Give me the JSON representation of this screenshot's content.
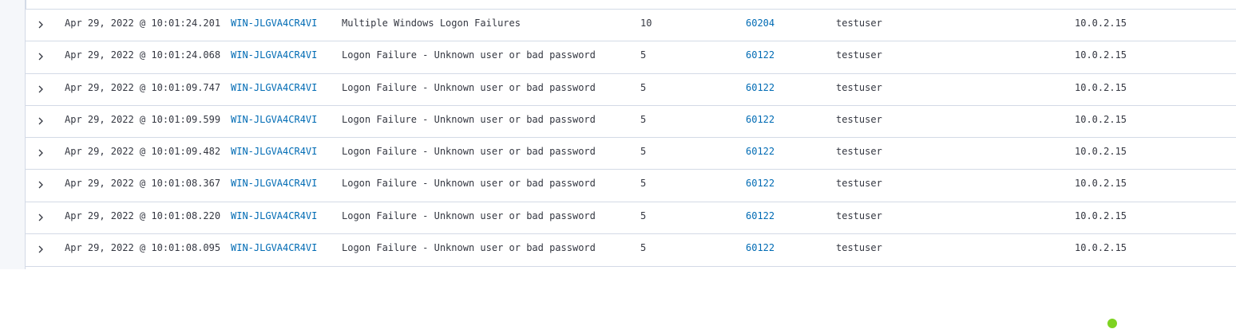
{
  "alerts_table": {
    "rows": [
      {
        "timestamp": "Apr 29, 2022 @ 10:01:24.201",
        "agent": "WIN-JLGVA4CR4VI",
        "description": "Multiple Windows Logon Failures",
        "level": "10",
        "rule_id": "60204",
        "user": "testuser",
        "ip": "10.0.2.15"
      },
      {
        "timestamp": "Apr 29, 2022 @ 10:01:24.068",
        "agent": "WIN-JLGVA4CR4VI",
        "description": "Logon Failure - Unknown user or bad password",
        "level": "5",
        "rule_id": "60122",
        "user": "testuser",
        "ip": "10.0.2.15"
      },
      {
        "timestamp": "Apr 29, 2022 @ 10:01:09.747",
        "agent": "WIN-JLGVA4CR4VI",
        "description": "Logon Failure - Unknown user or bad password",
        "level": "5",
        "rule_id": "60122",
        "user": "testuser",
        "ip": "10.0.2.15"
      },
      {
        "timestamp": "Apr 29, 2022 @ 10:01:09.599",
        "agent": "WIN-JLGVA4CR4VI",
        "description": "Logon Failure - Unknown user or bad password",
        "level": "5",
        "rule_id": "60122",
        "user": "testuser",
        "ip": "10.0.2.15"
      },
      {
        "timestamp": "Apr 29, 2022 @ 10:01:09.482",
        "agent": "WIN-JLGVA4CR4VI",
        "description": "Logon Failure - Unknown user or bad password",
        "level": "5",
        "rule_id": "60122",
        "user": "testuser",
        "ip": "10.0.2.15"
      },
      {
        "timestamp": "Apr 29, 2022 @ 10:01:08.367",
        "agent": "WIN-JLGVA4CR4VI",
        "description": "Logon Failure - Unknown user or bad password",
        "level": "5",
        "rule_id": "60122",
        "user": "testuser",
        "ip": "10.0.2.15"
      },
      {
        "timestamp": "Apr 29, 2022 @ 10:01:08.220",
        "agent": "WIN-JLGVA4CR4VI",
        "description": "Logon Failure - Unknown user or bad password",
        "level": "5",
        "rule_id": "60122",
        "user": "testuser",
        "ip": "10.0.2.15"
      },
      {
        "timestamp": "Apr 29, 2022 @ 10:01:08.095",
        "agent": "WIN-JLGVA4CR4VI",
        "description": "Logon Failure - Unknown user or bad password",
        "level": "5",
        "rule_id": "60122",
        "user": "testuser",
        "ip": "10.0.2.15"
      }
    ],
    "row_expander_icon": "chevron-right-icon"
  },
  "colors": {
    "link": "#006bb4",
    "text": "#343741",
    "border": "#d3dae6",
    "status_dot": "#7ed321"
  }
}
